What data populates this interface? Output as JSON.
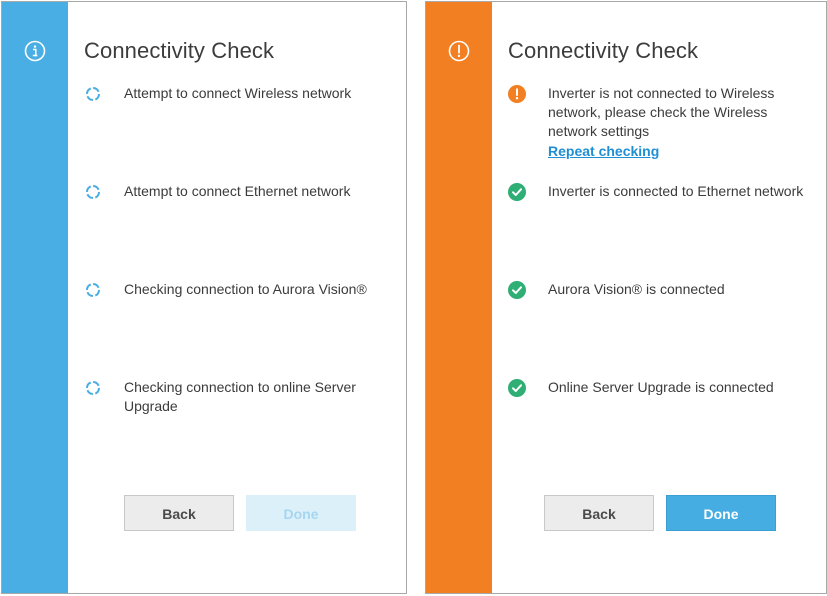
{
  "colors": {
    "checking_accent": "#48aee3",
    "error_accent": "#f27f22",
    "success_green": "#2fae75",
    "link_blue": "#1f8fd3"
  },
  "left_panel": {
    "header_icon": "info-icon",
    "title": "Connectivity Check",
    "items": [
      {
        "icon": "spinner-icon",
        "text": "Attempt to connect Wireless network"
      },
      {
        "icon": "spinner-icon",
        "text": "Attempt to connect Ethernet network"
      },
      {
        "icon": "spinner-icon",
        "text": "Checking connection to Aurora Vision®"
      },
      {
        "icon": "spinner-icon",
        "text": "Checking connection to online Server Upgrade"
      }
    ],
    "back_label": "Back",
    "done_label": "Done"
  },
  "right_panel": {
    "header_icon": "alert-icon",
    "title": "Connectivity Check",
    "items": [
      {
        "icon": "error-icon",
        "text": "Inverter is not connected to Wireless network, please check the Wireless network settings",
        "link": "Repeat checking"
      },
      {
        "icon": "check-icon",
        "text": "Inverter is connected to Ethernet network"
      },
      {
        "icon": "check-icon",
        "text": "Aurora Vision® is connected"
      },
      {
        "icon": "check-icon",
        "text": "Online Server Upgrade is connected"
      }
    ],
    "back_label": "Back",
    "done_label": "Done"
  }
}
